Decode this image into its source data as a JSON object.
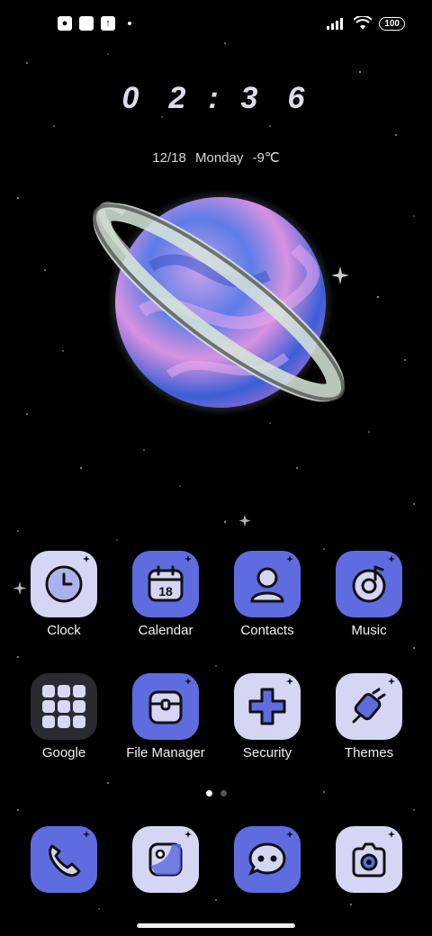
{
  "status_bar": {
    "battery_level": "100",
    "left_icons": [
      "notification-icon",
      "square-icon",
      "upload-icon"
    ],
    "right_icons": [
      "signal-icon",
      "wifi-icon",
      "battery-icon"
    ]
  },
  "lock_clock": {
    "h1": "0",
    "h2": "2",
    "colon": ":",
    "m1": "3",
    "m2": "6",
    "date": "12/18 Monday -9℃"
  },
  "apps_row1": [
    {
      "label": "Clock",
      "icon": "clock-icon"
    },
    {
      "label": "Calendar",
      "icon": "calendar-icon",
      "badge": "18"
    },
    {
      "label": "Contacts",
      "icon": "contacts-icon"
    },
    {
      "label": "Music",
      "icon": "music-icon"
    }
  ],
  "apps_row2": [
    {
      "label": "Google",
      "icon": "google-folder-icon"
    },
    {
      "label": "File Manager",
      "icon": "file-manager-icon"
    },
    {
      "label": "Security",
      "icon": "security-icon"
    },
    {
      "label": "Themes",
      "icon": "themes-icon"
    }
  ],
  "dock": [
    {
      "icon": "phone-icon"
    },
    {
      "icon": "gallery-icon"
    },
    {
      "icon": "messages-icon"
    },
    {
      "icon": "camera-icon"
    }
  ],
  "pages": {
    "current": 1,
    "total": 2
  },
  "colors": {
    "tile_light": "#d4d6f4",
    "tile_blue": "#5f6ce0",
    "planet_pink": "#d88fe0",
    "planet_blue": "#4f6fe0"
  }
}
